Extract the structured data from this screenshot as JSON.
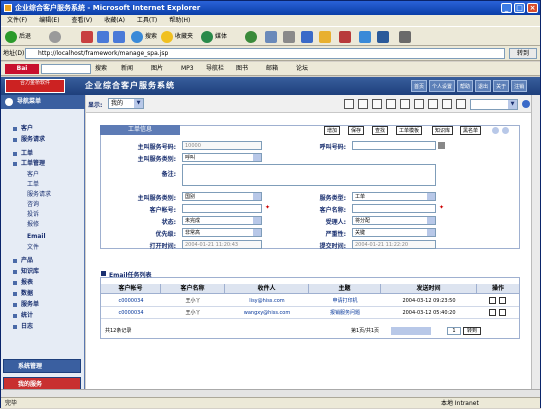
{
  "window": {
    "title": "企业综合客户服务系统 - Microsoft Internet Explorer"
  },
  "menu": [
    "文件(F)",
    "编辑(E)",
    "查看(V)",
    "收藏(A)",
    "工具(T)",
    "帮助(H)"
  ],
  "toolbar": {
    "back": "后退",
    "search": "搜索",
    "favorites": "收藏夹",
    "media": "媒体"
  },
  "address": {
    "label": "地址(D)",
    "url": "http://localhost/framework/manage_spa.jsp",
    "go": "转到"
  },
  "links": [
    "搜索",
    "新闻",
    "图片",
    "MP3",
    "导航栏",
    "图书",
    "邮箱",
    "论坛"
  ],
  "header": {
    "app_title": "企业综合客户服务系统",
    "logo": "合力金桥软件",
    "buttons": [
      "首页",
      "个人设置",
      "帮助",
      "退出",
      "关于",
      "注销"
    ]
  },
  "sidebar": {
    "title": "导航菜单",
    "items": [
      "客户",
      "服务请求",
      "工单",
      "工单管理",
      "产品",
      "知识库",
      "报表",
      "数据",
      "服务单",
      "统计",
      "日志"
    ],
    "subitems": [
      "客户",
      "工单",
      "服务请求",
      "咨询",
      "投诉",
      "报修",
      "Email",
      "文件"
    ],
    "bottom": [
      "系统管理",
      "我的服务"
    ]
  },
  "filter": {
    "label": "显示:",
    "value": "我的"
  },
  "panel": {
    "tab": "工单信息",
    "actions": [
      "增加",
      "保存",
      "查找",
      "工单模板",
      "知识库",
      "黑名单"
    ],
    "fields": {
      "main_number_label": "主叫服务号码:",
      "main_number": "10000",
      "call_label": "呼叫号码:",
      "service_type_label": "主叫服务类别:",
      "service_type": "呼叫",
      "remark_label": "备注:",
      "category_label": "主叫服务类别:",
      "category": "国别",
      "server_label": "服务类型:",
      "server": "工单",
      "customer_id_label": "客户帐号:",
      "customer_name_label": "客户名称:",
      "status_label": "状态:",
      "status": "未完成",
      "accept_label": "受理人:",
      "accept": "将分配",
      "priority_label": "优先级:",
      "priority": "非常高",
      "severity_label": "严重性:",
      "severity": "关键",
      "open_label": "打开时间:",
      "open_time": "2004-01-21 11:20:43",
      "submit_label": "提交时间:",
      "submit_time": "2004-01-21 11:22:20"
    }
  },
  "grid": {
    "title": "Email任务列表",
    "headers": [
      "客户帐号",
      "客户名称",
      "收件人",
      "主题",
      "发送时间",
      "操作"
    ],
    "rows": [
      [
        "c0000034",
        "王小丫",
        "lisy@hiss.com",
        "申请打印机",
        "2004-03-12 09:23:50"
      ],
      [
        "c0000034",
        "王小丫",
        "wangxy@hiss.com",
        "报销服务问题",
        "2004-03-12 05:40:20"
      ]
    ],
    "pager": "共12条记录",
    "pages": "第1页/共1页",
    "goto": "转到",
    "go": "1"
  },
  "status": {
    "text": "完毕",
    "zone": "本地 Intranet"
  }
}
